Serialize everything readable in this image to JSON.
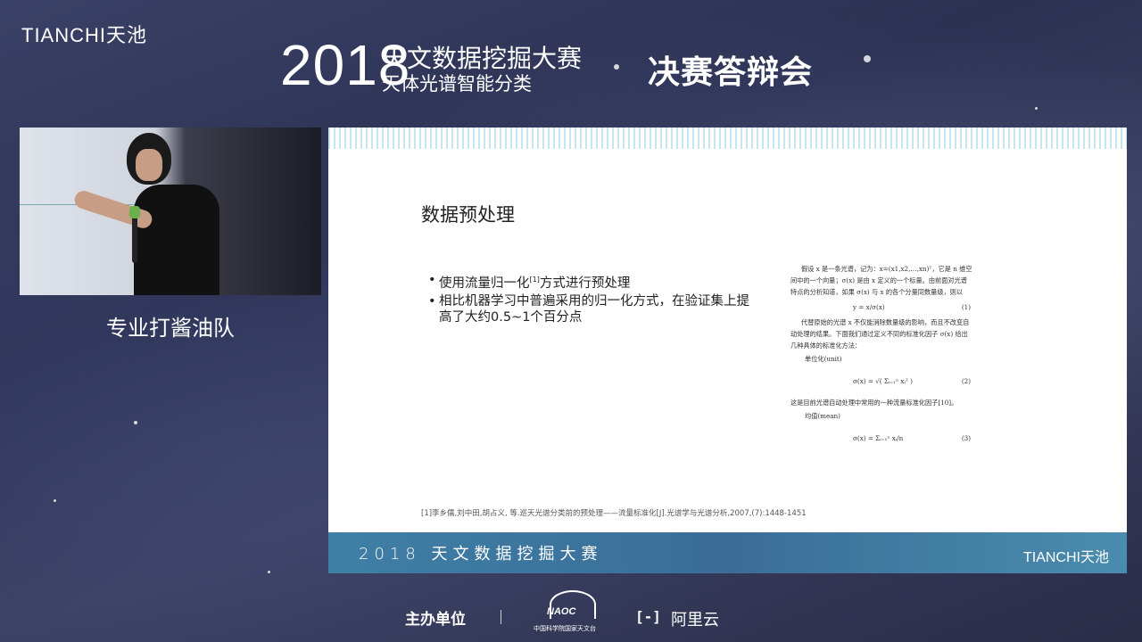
{
  "header": {
    "brand": "TIANCHI天池",
    "year": "2018",
    "title": "天文数据挖掘大赛",
    "subtitle": "天体光谱智能分类",
    "stage": "决赛答辩会"
  },
  "video": {
    "team_name": "专业打酱油队"
  },
  "slide": {
    "title": "数据预处理",
    "bullets": [
      {
        "text_before": "使用流量归一化",
        "sup": "[1]",
        "text_after": "方式进行预处理"
      },
      {
        "text_before": "相比机器学习中普遍采用的归一化方式，在验证集上提高了大约0.5~1个百分点",
        "sup": "",
        "text_after": ""
      }
    ],
    "paper": {
      "para1": "假设 x 是一条光谱，记为：x=(x1,x2,…,xn)ᵀ，它是 n 维空间中的一个向量；σ(x) 是由 x 定义的一个标量。由前面对光谱特点的分析知道，如果 σ(x) 与 x 的各个分量同数量级，则以",
      "eq1": "y = x/σ(x)",
      "eq1_num": "(1)",
      "para2": "代替原始的光谱 x 不仅能消除数量级的影响，而且不改变自动处理的结果。下面我们通过定义不同的标准化因子 σ(x) 给出几种具体的标准化方法：",
      "label_unit": "单位化(unit)",
      "eq2": "σ(x) = √( Σᵢ₌₁ⁿ xᵢ² )",
      "eq2_num": "(2)",
      "para3": "这是目前光谱自动处理中常用的一种流量标准化因子[10]。",
      "label_mean": "均值(mean)",
      "eq3": "σ(x) = Σᵢ₌₁ⁿ xᵢ/n",
      "eq3_num": "(3)"
    },
    "footnote": "[1]李乡儒,刘中田,胡占义, 等.巡天光谱分类前的预处理——流量标准化[J].光谱学与光谱分析,2007,(7):1448-1451",
    "bottom_title": "2018 天文数据挖掘大赛",
    "bottom_brand": "TIANCHI天池"
  },
  "footer": {
    "host_label": "主办单位",
    "naoc_logo": "NAOC",
    "naoc_caption": "中国科学院国家天文台",
    "aliyun_icon": "[-]",
    "aliyun_name": "阿里云"
  }
}
